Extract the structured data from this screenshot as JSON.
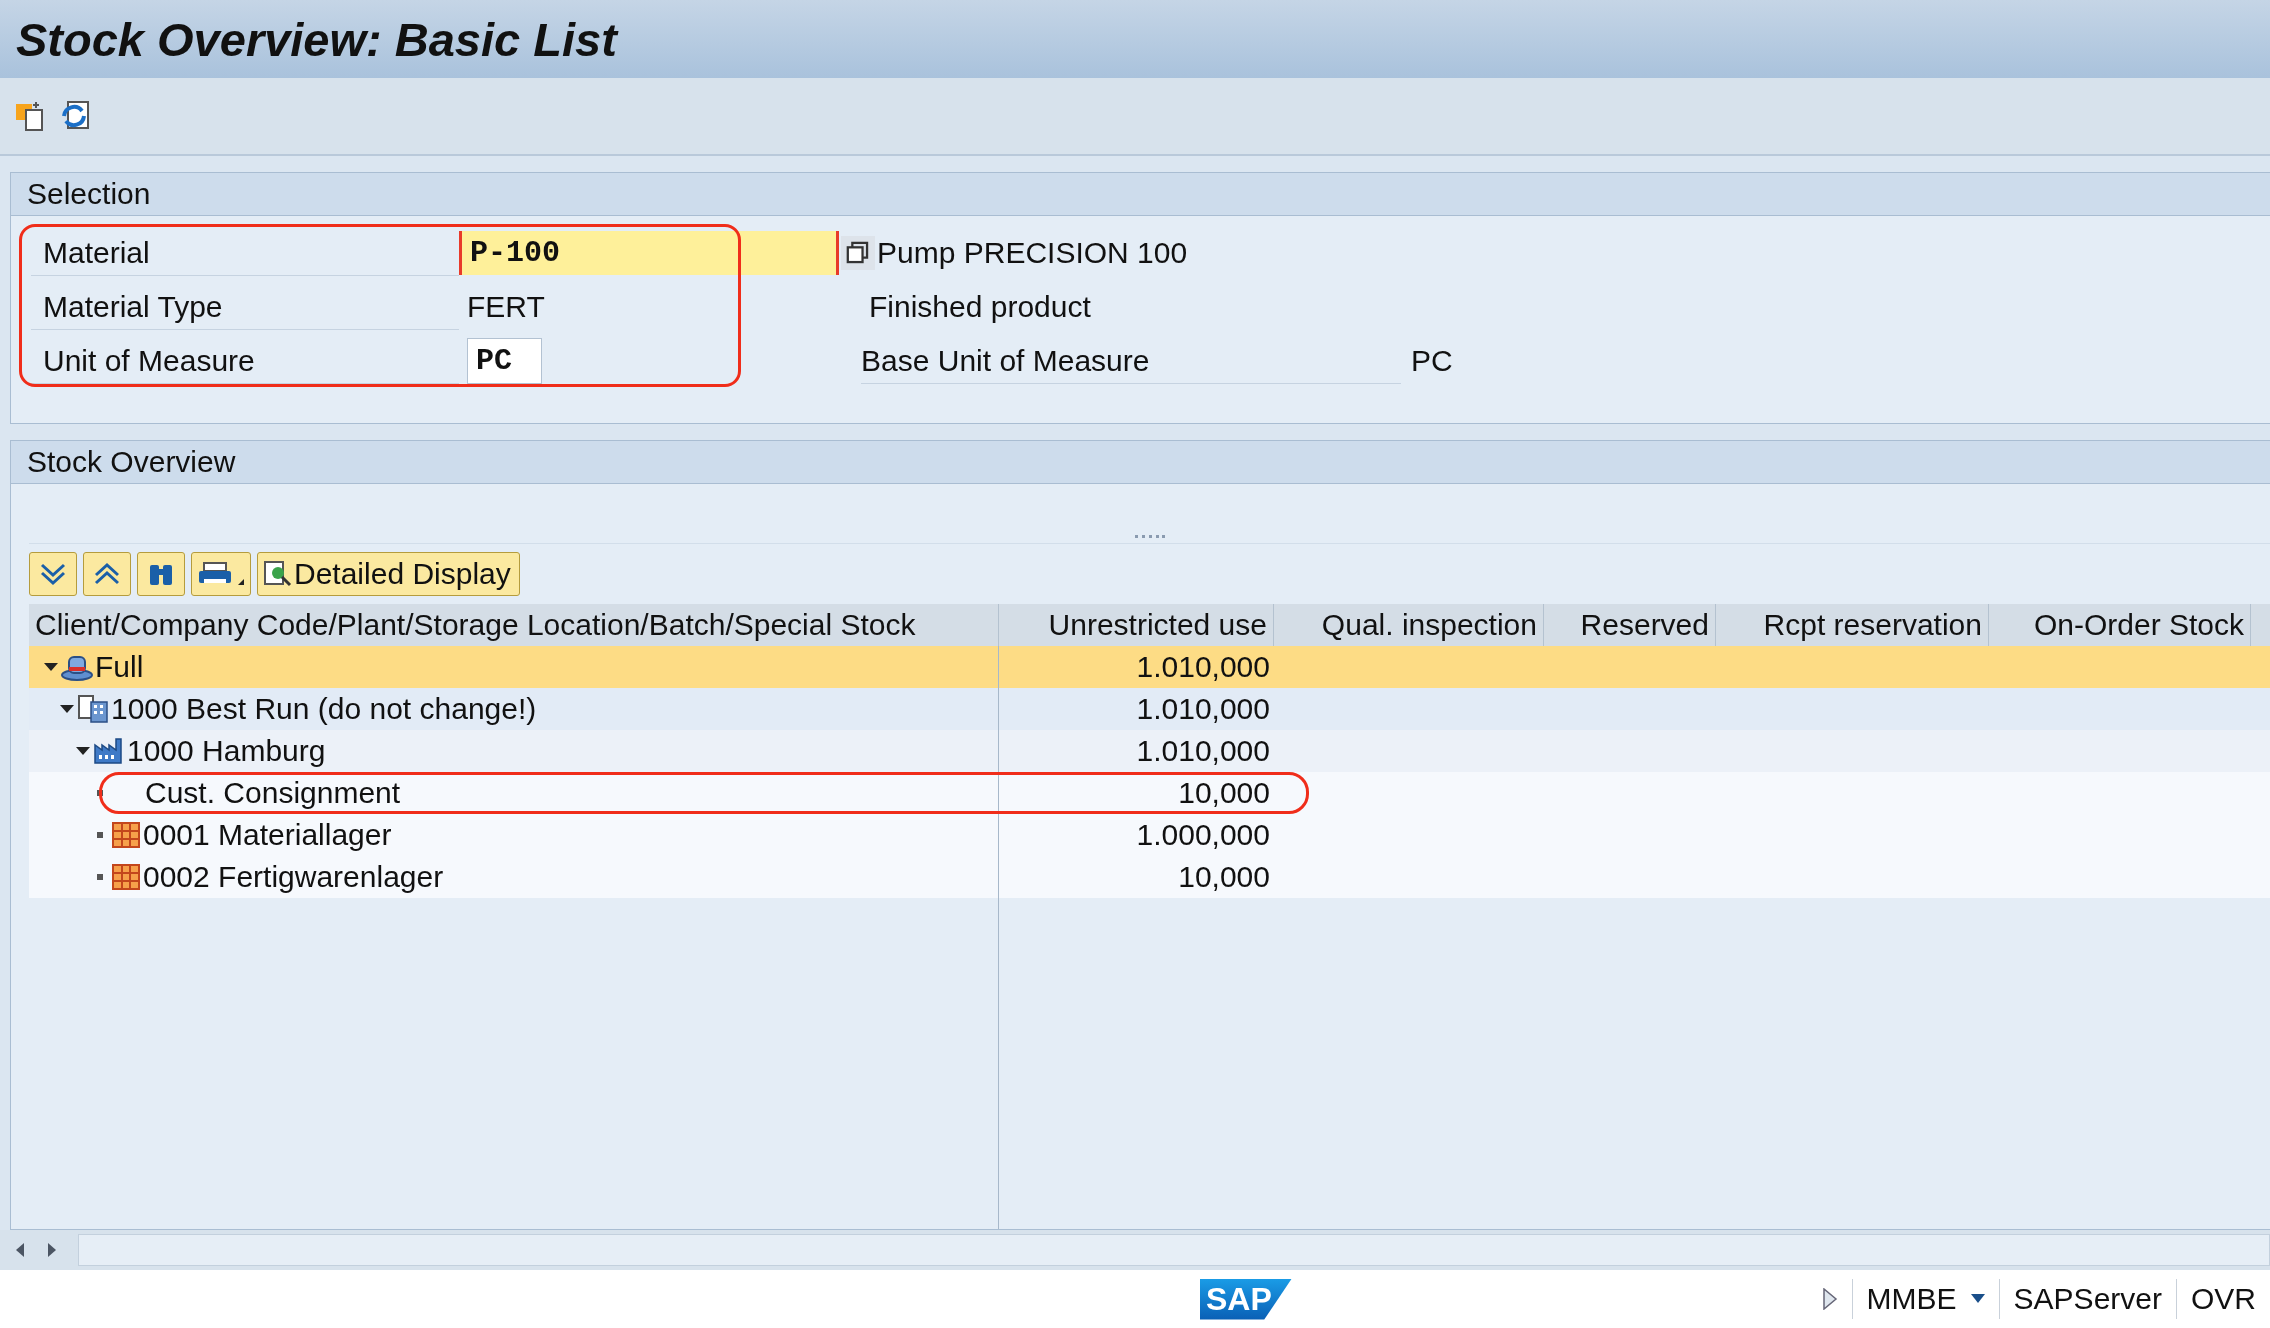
{
  "window": {
    "title": "Stock Overview: Basic List"
  },
  "selection": {
    "title": "Selection",
    "highlighted": true,
    "material": {
      "label": "Material",
      "value": "P-100",
      "focused": true,
      "description": "Pump PRECISION 100"
    },
    "material_type": {
      "label": "Material Type",
      "value": "FERT",
      "description": "Finished product"
    },
    "unit": {
      "label": "Unit of Measure",
      "value": "PC",
      "base_label": "Base Unit of Measure",
      "base_value": "PC"
    }
  },
  "overview": {
    "title": "Stock Overview",
    "detail_button": "Detailed Display",
    "columns": [
      "Client/Company Code/Plant/Storage Location/Batch/Special Stock",
      "Unrestricted use",
      "Qual. inspection",
      "Reserved",
      "Rcpt reservation",
      "On-Order Stock"
    ],
    "tree": [
      {
        "kind": "client",
        "label": "Full",
        "unrestricted": "1.010,000",
        "expanded": true,
        "selected": true,
        "highlighted": false,
        "children": [
          {
            "kind": "company",
            "label": "1000 Best Run (do not change!)",
            "unrestricted": "1.010,000",
            "expanded": true,
            "selected": false,
            "highlighted": false,
            "children": [
              {
                "kind": "plant",
                "label": "1000 Hamburg",
                "unrestricted": "1.010,000",
                "expanded": true,
                "selected": false,
                "highlighted": false,
                "children": [
                  {
                    "kind": "special",
                    "label": "Cust. Consignment",
                    "unrestricted": "10,000",
                    "selected": false,
                    "highlighted": true
                  },
                  {
                    "kind": "storage",
                    "label": "0001 Materiallager",
                    "unrestricted": "1.000,000",
                    "selected": false,
                    "highlighted": false
                  },
                  {
                    "kind": "storage",
                    "label": "0002 Fertigwarenlager",
                    "unrestricted": "10,000",
                    "selected": false,
                    "highlighted": false
                  }
                ]
              }
            ]
          }
        ]
      }
    ]
  },
  "status_bar": {
    "logo": "SAP",
    "transaction": "MMBE",
    "server": "SAPServer",
    "mode": "OVR"
  }
}
